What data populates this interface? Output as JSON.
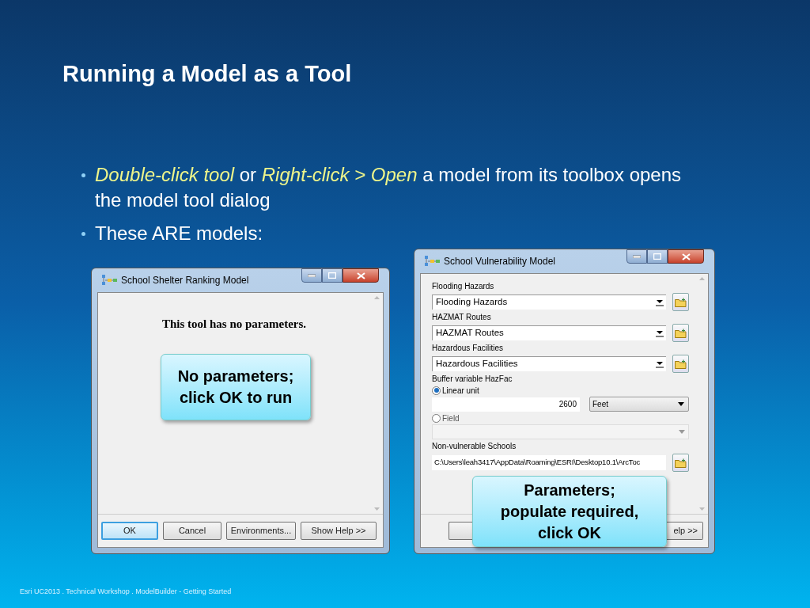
{
  "title": "Running a Model as a Tool",
  "bullets": [
    {
      "text": "*Double-click tool* or *Right-click > Open* a model from its toolbox opens  the model tool dialog"
    },
    {
      "text": "These ARE models:"
    }
  ],
  "dialogs": [
    {
      "title": "School Shelter Ranking Model",
      "message": "This tool has no parameters.",
      "callout": [
        "No parameters;",
        "click OK to run"
      ],
      "buttons": [
        {
          "label": "OK",
          "default": true
        },
        {
          "label": "Cancel",
          "default": false
        },
        {
          "label": "Environments...",
          "default": false
        },
        {
          "label": "Show Help >>",
          "default": false
        }
      ]
    },
    {
      "title": "School Vulnerability Model",
      "callout": [
        "Parameters;",
        "populate required,",
        "click OK"
      ],
      "params": [
        {
          "kind": "combo",
          "label": "Flooding Hazards",
          "value": "Flooding Hazards"
        },
        {
          "kind": "combo",
          "label": "HAZMAT Routes",
          "value": "HAZMAT Routes"
        },
        {
          "kind": "combo",
          "label": "Hazardous Facilities",
          "value": "Hazardous Facilities"
        },
        {
          "kind": "choice",
          "label": "Buffer variable HazFac",
          "options": [
            {
              "label": "Linear unit",
              "selected": true,
              "value": "2600",
              "unit": "Feet"
            },
            {
              "label": "Field",
              "selected": false
            }
          ]
        },
        {
          "kind": "path",
          "label": "Non-vulnerable Schools",
          "value": "C:\\Users\\leah3417\\AppData\\Roaming\\ESRI\\Desktop10.1\\ArcToc"
        }
      ],
      "buttons": [
        {
          "default": false
        },
        {
          "label": "elp >>",
          "default": false
        }
      ]
    }
  ],
  "footer": "Esri UC2013 . Technical Workshop . ModelBuilder - Getting Started"
}
